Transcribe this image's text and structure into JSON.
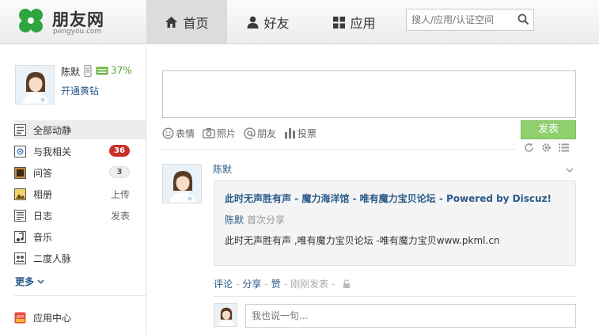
{
  "brand": {
    "name": "朋友网",
    "domain": "pengyou.com",
    "color": "#2ea53f"
  },
  "nav": {
    "tabs": [
      {
        "label": "首页",
        "icon": "home-icon",
        "active": true
      },
      {
        "label": "好友",
        "icon": "person-icon",
        "active": false
      },
      {
        "label": "应用",
        "icon": "grid-icon",
        "active": false
      }
    ]
  },
  "search": {
    "placeholder": "搜人/应用/认证空间",
    "icon": "search-icon"
  },
  "profile": {
    "name": "陈默",
    "battery_pct": "37%",
    "vip_link": "开通黄钻"
  },
  "sidebar": {
    "items": [
      {
        "label": "全部动静",
        "icon": "feed-icon",
        "active": true
      },
      {
        "label": "与我相关",
        "icon": "mention-icon",
        "badge": "36"
      },
      {
        "label": "问答",
        "icon": "qa-icon",
        "badge": "3"
      },
      {
        "label": "相册",
        "icon": "album-icon",
        "extra": "上传"
      },
      {
        "label": "日志",
        "icon": "blog-icon",
        "extra": "发表"
      },
      {
        "label": "音乐",
        "icon": "music-icon"
      },
      {
        "label": "二度人脉",
        "icon": "contacts-icon"
      }
    ],
    "more": "更多",
    "app_center": "应用中心"
  },
  "composer": {
    "tools": [
      "表情",
      "照片",
      "朋友",
      "投票"
    ],
    "publish": "发表"
  },
  "post": {
    "author": "陈默",
    "share_title": "此时无声胜有声 - 魔力海洋馆 - 唯有魔力宝贝论坛 - Powered by Discuz!",
    "sharer": "陈默",
    "share_note": "首次分享",
    "share_body": "此时无声胜有声 ,唯有魔力宝贝论坛 -唯有魔力宝贝www.pkml.cn",
    "actions": {
      "comment": "评论",
      "share": "分享",
      "like": "赞",
      "time": "刚刚发表"
    },
    "comment_placeholder": "我也说一句..."
  }
}
